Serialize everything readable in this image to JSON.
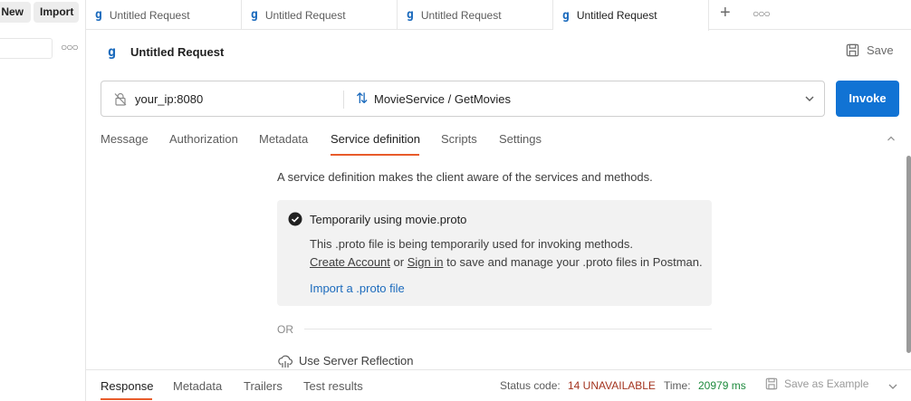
{
  "sidebar": {
    "new_label": "New",
    "import_label": "Import"
  },
  "tabs": [
    {
      "label": "Untitled Request",
      "icon": "grpc-icon"
    },
    {
      "label": "Untitled Request",
      "icon": "grpc-icon"
    },
    {
      "label": "Untitled Request",
      "icon": "grpc-icon"
    },
    {
      "label": "Untitled Request",
      "icon": "grpc-icon",
      "active": true
    }
  ],
  "header": {
    "icon_glyph": "g",
    "title": "Untitled Request",
    "save_label": "Save"
  },
  "urlbar": {
    "url": "your_ip:8080",
    "method": "MovieService / GetMovies",
    "invoke_label": "Invoke"
  },
  "request_tabs": [
    {
      "label": "Message"
    },
    {
      "label": "Authorization"
    },
    {
      "label": "Metadata"
    },
    {
      "label": "Service definition",
      "active": true
    },
    {
      "label": "Scripts"
    },
    {
      "label": "Settings"
    }
  ],
  "service_definition": {
    "description": "A service definition makes the client aware of the services and methods.",
    "info_title": "Temporarily using movie.proto",
    "info_line1": "This .proto file is being temporarily used for invoking methods.",
    "create_account": "Create Account",
    "or_word": "or",
    "sign_in": "Sign in",
    "info_line2_rest": "to save and manage your .proto files in Postman.",
    "import_link": "Import a .proto file",
    "or_separator": "OR",
    "reflection_label": "Use Server Reflection"
  },
  "response": {
    "tabs": [
      {
        "label": "Response",
        "active": true
      },
      {
        "label": "Metadata"
      },
      {
        "label": "Trailers"
      },
      {
        "label": "Test results"
      }
    ],
    "status_label": "Status code:",
    "status_value": "14 UNAVAILABLE",
    "time_label": "Time:",
    "time_value": "20979 ms",
    "save_example_label": "Save as Example"
  },
  "colors": {
    "accent_blue": "#1173d4",
    "active_underline": "#e85b2a",
    "status_error": "#a3331e",
    "time_ok": "#1d8a3d"
  }
}
